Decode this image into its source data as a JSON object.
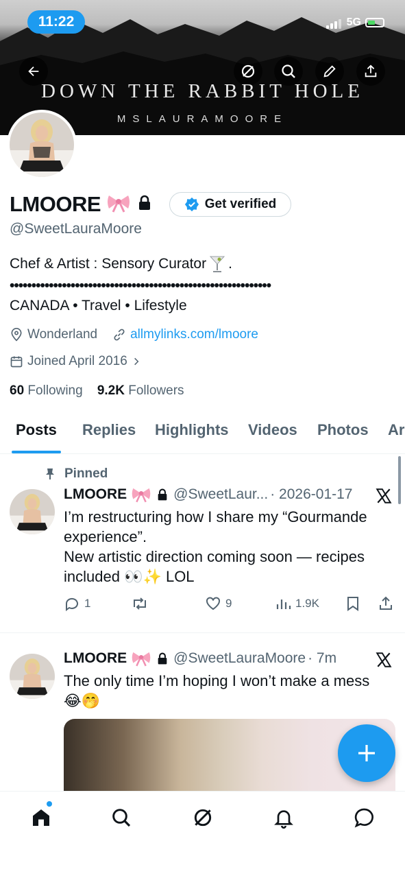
{
  "status_bar": {
    "time": "11:22",
    "network": "5G"
  },
  "banner": {
    "title": "DOWN THE RABBIT HOLE",
    "subtitle": "MSLAURAMOORE"
  },
  "profile": {
    "name": "LMOORE",
    "bow_emoji": "🎀",
    "verify_label": "Get verified",
    "handle": "@SweetLauraMoore",
    "bio_line1": "Chef & Artist : Sensory Curator",
    "bio_line1_end": ".",
    "bio_dots": "••••••••••••••••••••••••••••••••••••••••••••••••••••••••••••",
    "bio_line2": "CANADA • Travel • Lifestyle",
    "location": "Wonderland",
    "link": "allmylinks.com/lmoore",
    "joined": "Joined April 2016",
    "following_count": "60",
    "following_label": "Following",
    "followers_count": "9.2K",
    "followers_label": "Followers"
  },
  "tabs": [
    "Posts",
    "Replies",
    "Highlights",
    "Videos",
    "Photos",
    "Ar"
  ],
  "posts": [
    {
      "pinned_label": "Pinned",
      "name": "LMOORE",
      "handle": "@SweetLaur...",
      "time": "· 2026-01-17",
      "text_line1": "I’m restructuring how I share my “Gourmande experience”.",
      "text_line2": "New artistic direction coming soon — recipes included 👀✨ LOL",
      "replies": "1",
      "likes": "9",
      "views": "1.9K"
    },
    {
      "name": "LMOORE",
      "handle": "@SweetLauraMoore",
      "time": "· 7m",
      "text": "The only time I’m hoping I won’t make a mess 😂🤭"
    }
  ],
  "colors": {
    "accent": "#1d9bf0",
    "text": "#0f1419",
    "muted": "#536471"
  },
  "icons": [
    "back-arrow-icon",
    "grok-icon",
    "search-icon",
    "edit-icon",
    "share-icon",
    "lock-icon",
    "verified-badge-icon",
    "location-icon",
    "link-icon",
    "calendar-icon",
    "pin-icon",
    "reply-icon",
    "retweet-icon",
    "like-icon",
    "views-icon",
    "bookmark-icon",
    "x-logo-icon",
    "plus-icon",
    "home-icon",
    "notifications-icon",
    "messages-icon"
  ]
}
